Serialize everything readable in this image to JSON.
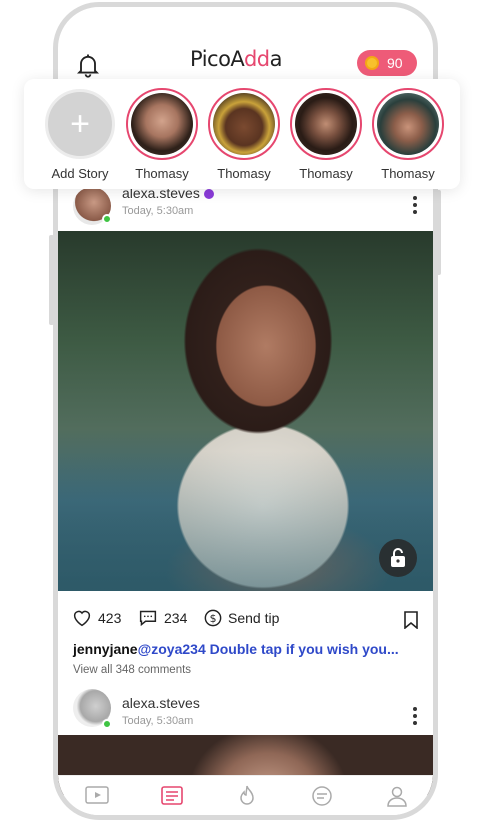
{
  "header": {
    "logo_main": "PicoA",
    "logo_accent": "dd",
    "logo_end": "a",
    "coins": "90"
  },
  "stories": [
    {
      "label": "Add Story"
    },
    {
      "label": "Thomasy"
    },
    {
      "label": "Thomasy"
    },
    {
      "label": "Thomasy"
    },
    {
      "label": "Thomasy"
    }
  ],
  "post1": {
    "username": "alexa.steves",
    "time": "Today, 5:30am",
    "likes": "423",
    "comments": "234",
    "tip_label": "Send tip",
    "caption_user": "jennyjane",
    "caption_text": "@zoya234 Double tap if you wish you...",
    "view_all": "View all 348 comments"
  },
  "post2": {
    "username": "alexa.steves",
    "time": "Today, 5:30am"
  },
  "colors": {
    "accent": "#e6476f",
    "coin_badge": "#ee5b78",
    "mention": "#2f49c9",
    "online": "#3fc443"
  }
}
